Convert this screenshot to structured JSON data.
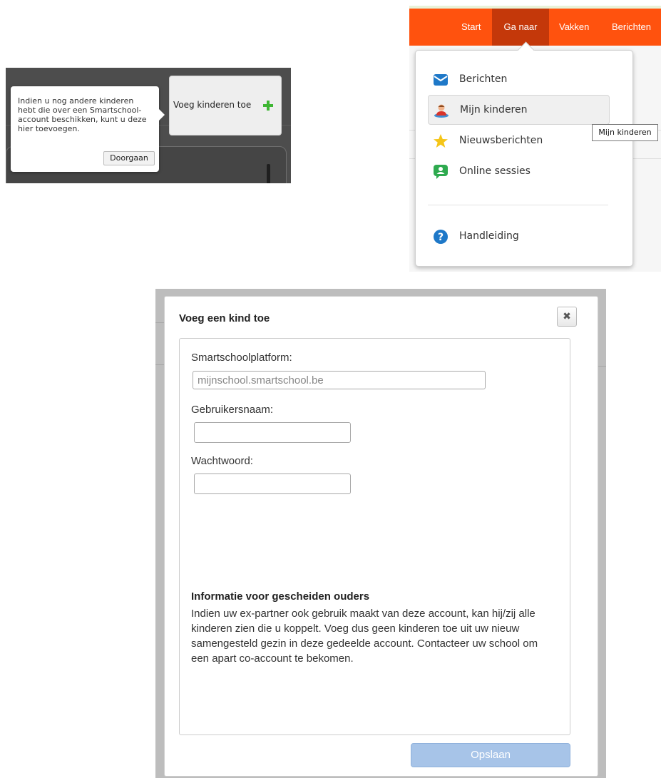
{
  "tooltip_panel": {
    "tooltip_text": "Indien u nog andere kinderen hebt die over een Smartschool-account beschikken, kunt u deze hier toevoegen.",
    "continue_button": "Doorgaan",
    "add_children_label": "Voeg kinderen toe",
    "add_icon": "plus-icon"
  },
  "nav_panel": {
    "nav_items": [
      "Start",
      "Ga naar",
      "Vakken",
      "Berichten"
    ],
    "active_nav": "Ga naar",
    "menu_items": [
      {
        "label": "Berichten",
        "icon": "envelope-icon"
      },
      {
        "label": "Mijn kinderen",
        "icon": "person-icon"
      },
      {
        "label": "Nieuwsberichten",
        "icon": "star-icon"
      },
      {
        "label": "Online sessies",
        "icon": "chat-person-icon"
      },
      {
        "label": "Handleiding",
        "icon": "question-icon"
      }
    ],
    "hover_tooltip": "Mijn kinderen",
    "accent_color": "#ff520e"
  },
  "modal": {
    "title": "Voeg een kind toe",
    "close_icon": "close-icon",
    "platform_label": "Smartschoolplatform:",
    "platform_placeholder": "mijnschool.smartschool.be",
    "username_label": "Gebruikersnaam:",
    "password_label": "Wachtwoord:",
    "info_title": "Informatie voor gescheiden ouders",
    "info_text": "Indien uw ex-partner ook gebruik maakt van deze account, kan hij/zij alle kinderen zien die u koppelt. Voeg dus geen kinderen toe uit uw nieuw samengesteld gezin in deze gedeelde account. Contacteer uw school om een apart co-account te bekomen.",
    "save_button": "Opslaan"
  }
}
